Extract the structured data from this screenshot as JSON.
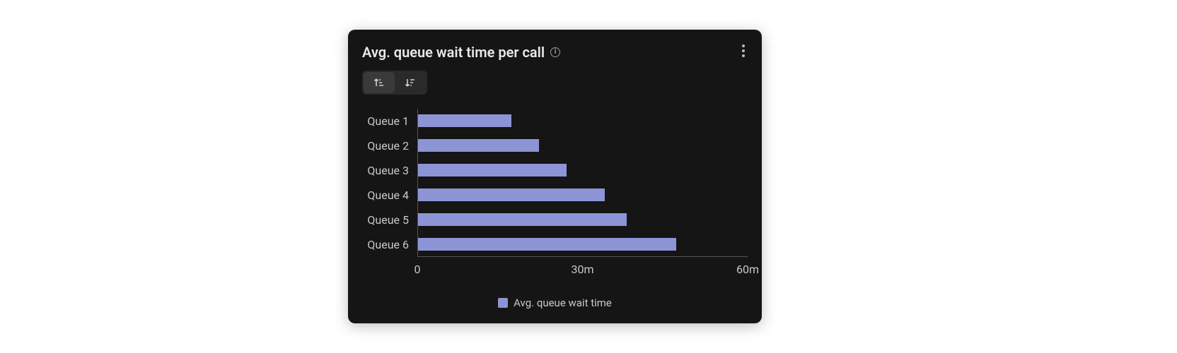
{
  "card": {
    "title": "Avg. queue wait time per call"
  },
  "x_ticks": {
    "t0": "0",
    "t1": "30m",
    "t2": "60m"
  },
  "legend": {
    "label": "Avg. queue wait time"
  },
  "chart_data": {
    "type": "bar",
    "orientation": "horizontal",
    "title": "Avg. queue wait time per call",
    "xlabel": "",
    "ylabel": "",
    "xlim": [
      0,
      60
    ],
    "x_unit": "minutes",
    "categories": [
      "Queue 1",
      "Queue 2",
      "Queue 3",
      "Queue 4",
      "Queue 5",
      "Queue 6"
    ],
    "series": [
      {
        "name": "Avg. queue wait time",
        "color": "#8d94d6",
        "values": [
          17,
          22,
          27,
          34,
          38,
          47
        ]
      }
    ],
    "x_ticks": [
      0,
      30,
      60
    ],
    "x_tick_labels": [
      "0",
      "30m",
      "60m"
    ],
    "legend_position": "bottom"
  }
}
